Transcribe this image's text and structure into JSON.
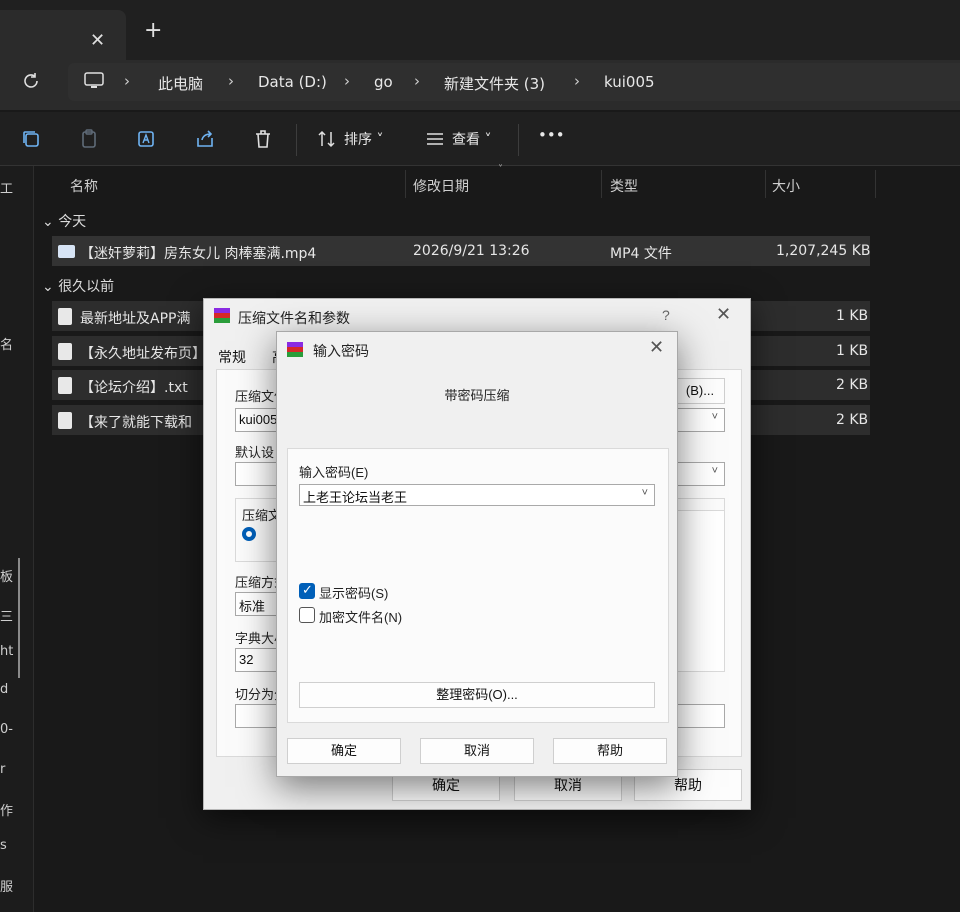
{
  "tabs": {
    "close_glyph": "✕",
    "new_glyph": "+"
  },
  "address": {
    "breadcrumb": [
      "此电脑",
      "Data (D:)",
      "go",
      "新建文件夹 (3)",
      "kui005"
    ],
    "separator": "›"
  },
  "toolbar": {
    "sort_label": "排序",
    "view_label": "查看",
    "more": "•••"
  },
  "leftnav_glyphs": [
    "工",
    "名",
    "板",
    "三",
    "ht",
    "d",
    "0-",
    "r",
    "作",
    "s",
    "服"
  ],
  "columns": {
    "name": "名称",
    "date": "修改日期",
    "type": "类型",
    "size": "大小"
  },
  "groups": {
    "today": "今天",
    "long_ago": "很久以前"
  },
  "files_today": [
    {
      "name": "【迷奸萝莉】房东女儿 肉棒塞满.mp4",
      "date": "2026/9/21 13:26",
      "type": "MP4 文件",
      "size": "1,207,245 KB"
    }
  ],
  "files_old": [
    {
      "name": "最新地址及APP满",
      "size": "1 KB"
    },
    {
      "name": "【永久地址发布页】",
      "size": "1 KB"
    },
    {
      "name": "【论坛介绍】.txt",
      "size": "2 KB"
    },
    {
      "name": "【来了就能下载和",
      "size": "2 KB"
    }
  ],
  "main_dialog": {
    "title": "压缩文件名和参数",
    "help_glyph": "?",
    "close_glyph": "✕",
    "tab_general": "常规",
    "tab_other": "高",
    "archive_name_label": "压缩文件",
    "archive_name_value": "kui005",
    "browse_label": "(B)...",
    "profile_label": "默认设",
    "format_label": "压缩文",
    "method_label": "压缩方式",
    "method_value": "标准",
    "dict_label": "字典大小",
    "dict_value": "32",
    "split_label": "切分为分",
    "ok": "确定",
    "cancel": "取消",
    "help": "帮助"
  },
  "password_dialog": {
    "title": "输入密码",
    "close_glyph": "✕",
    "subtitle": "带密码压缩",
    "enter_label": "输入密码(E)",
    "password_value": "上老王论坛当老王",
    "show_password_label": "显示密码(S)",
    "show_password_checked": true,
    "encrypt_names_label": "加密文件名(N)",
    "encrypt_names_checked": false,
    "organize_label": "整理密码(O)...",
    "ok": "确定",
    "cancel": "取消",
    "help": "帮助"
  }
}
